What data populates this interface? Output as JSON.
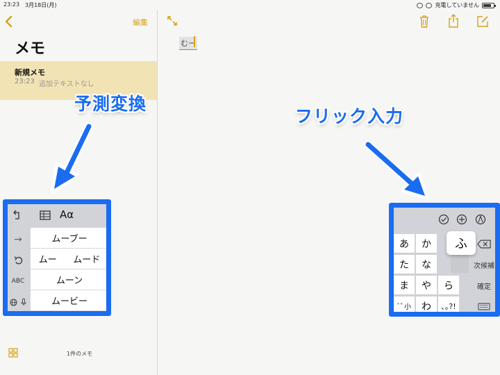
{
  "status_bar": {
    "time": "23:23",
    "date": "3月18日(月)",
    "charging_text": "充電していません"
  },
  "sidebar": {
    "edit_label": "編集",
    "title": "メモ",
    "note": {
      "title": "新規メモ",
      "time": "23:23",
      "preview": "追加テキストなし"
    },
    "count_label": "1件のメモ"
  },
  "editor": {
    "typed_text": "むー"
  },
  "annotations": {
    "left_label": "予測変換",
    "right_label": "フリック入力"
  },
  "prediction_keyboard": {
    "toolbar_aa": "Aα",
    "abc_label": "ABC",
    "next_arrow": "→",
    "candidates_row1": "ムーブー",
    "candidates_row2_a": "ムー",
    "candidates_row2_b": "ムード",
    "candidates_row3": "ムーン",
    "candidates_row4": "ムービー"
  },
  "flick_keyboard": {
    "keys_row1": [
      "あ",
      "か"
    ],
    "keys_row2": [
      "た",
      "な"
    ],
    "keys_row3": [
      "ま",
      "や",
      "ら"
    ],
    "keys_row4": [
      "ﾞﾟ小",
      "わ",
      "､｡?!"
    ],
    "popup_char": "ふ",
    "next_candidate_label": "次候補",
    "confirm_label": "確定"
  },
  "colors": {
    "accent": "#d5a21b",
    "annotation_blue": "#1a6cf0",
    "note_highlight": "#f2e3b4"
  }
}
